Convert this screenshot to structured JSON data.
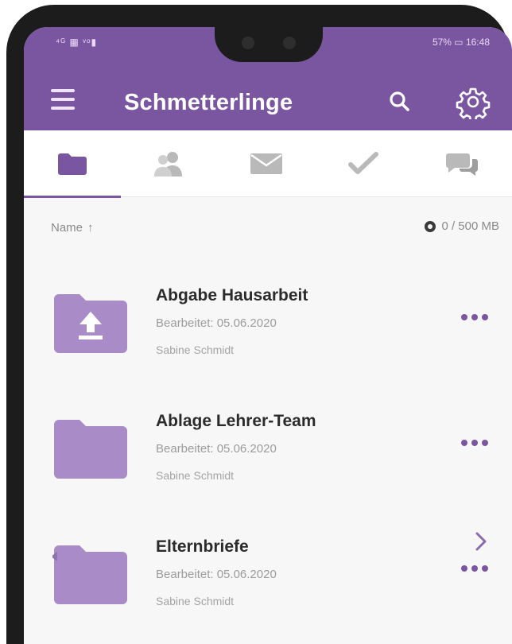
{
  "status": {
    "left": "⁴ᴳ ▦ ᵛᵒ▮",
    "right": "57% ▭ 16:48"
  },
  "header": {
    "title": "Schmetterlinge",
    "menu_icon": "hamburger-icon",
    "search_icon": "search-icon",
    "settings_icon": "gear-icon"
  },
  "tabs": [
    {
      "icon": "folder-icon",
      "active": true
    },
    {
      "icon": "users-icon",
      "active": false
    },
    {
      "icon": "mail-icon",
      "active": false
    },
    {
      "icon": "checkmark-icon",
      "active": false
    },
    {
      "icon": "chat-icon",
      "active": false
    }
  ],
  "list": {
    "sort_label": "Name",
    "sort_arrow": "↑",
    "storage": "0 / 500 MB",
    "items": [
      {
        "title": "Abgabe Hausarbeit",
        "edited": "Bearbeitet: 05.06.2020",
        "owner": "Sabine Schmidt",
        "folder_icon": "upload-folder-icon"
      },
      {
        "title": "Ablage Lehrer-Team",
        "edited": "Bearbeitet: 05.06.2020",
        "owner": "Sabine Schmidt",
        "folder_icon": "folder-icon"
      },
      {
        "title": "Elternbriefe",
        "edited": "Bearbeitet: 05.06.2020",
        "owner": "Sabine Schmidt",
        "folder_icon": "shared-folder-icon"
      }
    ]
  },
  "colors": {
    "accent": "#7a55a0",
    "folder": "#a98cc7",
    "tab_icon_inactive": "#b9b9b9"
  }
}
